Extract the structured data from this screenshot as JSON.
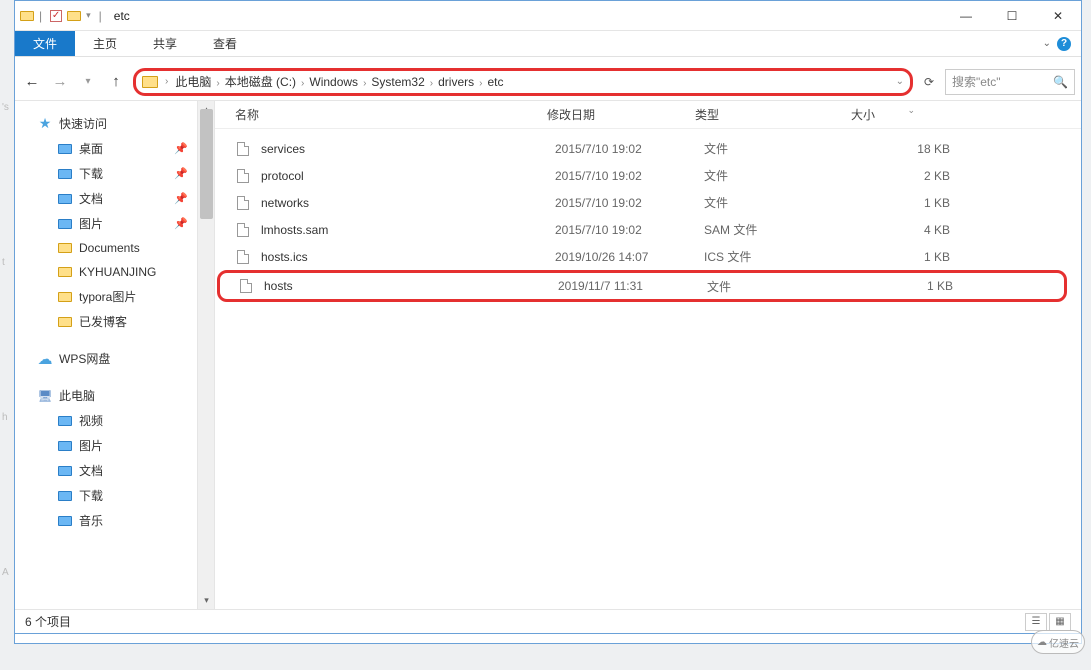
{
  "title": "etc",
  "ribbon": {
    "file": "文件",
    "home": "主页",
    "share": "共享",
    "view": "查看"
  },
  "breadcrumb": [
    "此电脑",
    "本地磁盘 (C:)",
    "Windows",
    "System32",
    "drivers",
    "etc"
  ],
  "search_placeholder": "搜索\"etc\"",
  "columns": {
    "name": "名称",
    "date": "修改日期",
    "type": "类型",
    "size": "大小"
  },
  "files": [
    {
      "name": "services",
      "date": "2015/7/10 19:02",
      "type": "文件",
      "size": "18 KB",
      "highlight": false
    },
    {
      "name": "protocol",
      "date": "2015/7/10 19:02",
      "type": "文件",
      "size": "2 KB",
      "highlight": false
    },
    {
      "name": "networks",
      "date": "2015/7/10 19:02",
      "type": "文件",
      "size": "1 KB",
      "highlight": false
    },
    {
      "name": "lmhosts.sam",
      "date": "2015/7/10 19:02",
      "type": "SAM 文件",
      "size": "4 KB",
      "highlight": false
    },
    {
      "name": "hosts.ics",
      "date": "2019/10/26 14:07",
      "type": "ICS 文件",
      "size": "1 KB",
      "highlight": false
    },
    {
      "name": "hosts",
      "date": "2019/11/7 11:31",
      "type": "文件",
      "size": "1 KB",
      "highlight": true
    }
  ],
  "sidebar": {
    "quick_access": {
      "label": "快速访问",
      "items": [
        {
          "label": "桌面",
          "pinned": true,
          "ico": "b"
        },
        {
          "label": "下载",
          "pinned": true,
          "ico": "b"
        },
        {
          "label": "文档",
          "pinned": true,
          "ico": "b"
        },
        {
          "label": "图片",
          "pinned": true,
          "ico": "b"
        },
        {
          "label": "Documents",
          "pinned": false,
          "ico": "y"
        },
        {
          "label": "KYHUANJING",
          "pinned": false,
          "ico": "y"
        },
        {
          "label": "typora图片",
          "pinned": false,
          "ico": "y"
        },
        {
          "label": "已发博客",
          "pinned": false,
          "ico": "y"
        }
      ]
    },
    "wps": {
      "label": "WPS网盘"
    },
    "this_pc": {
      "label": "此电脑",
      "items": [
        {
          "label": "视频",
          "ico": "b"
        },
        {
          "label": "图片",
          "ico": "b"
        },
        {
          "label": "文档",
          "ico": "b"
        },
        {
          "label": "下载",
          "ico": "b"
        },
        {
          "label": "音乐",
          "ico": "b"
        }
      ]
    }
  },
  "status": "6 个项目",
  "watermark": "亿速云"
}
